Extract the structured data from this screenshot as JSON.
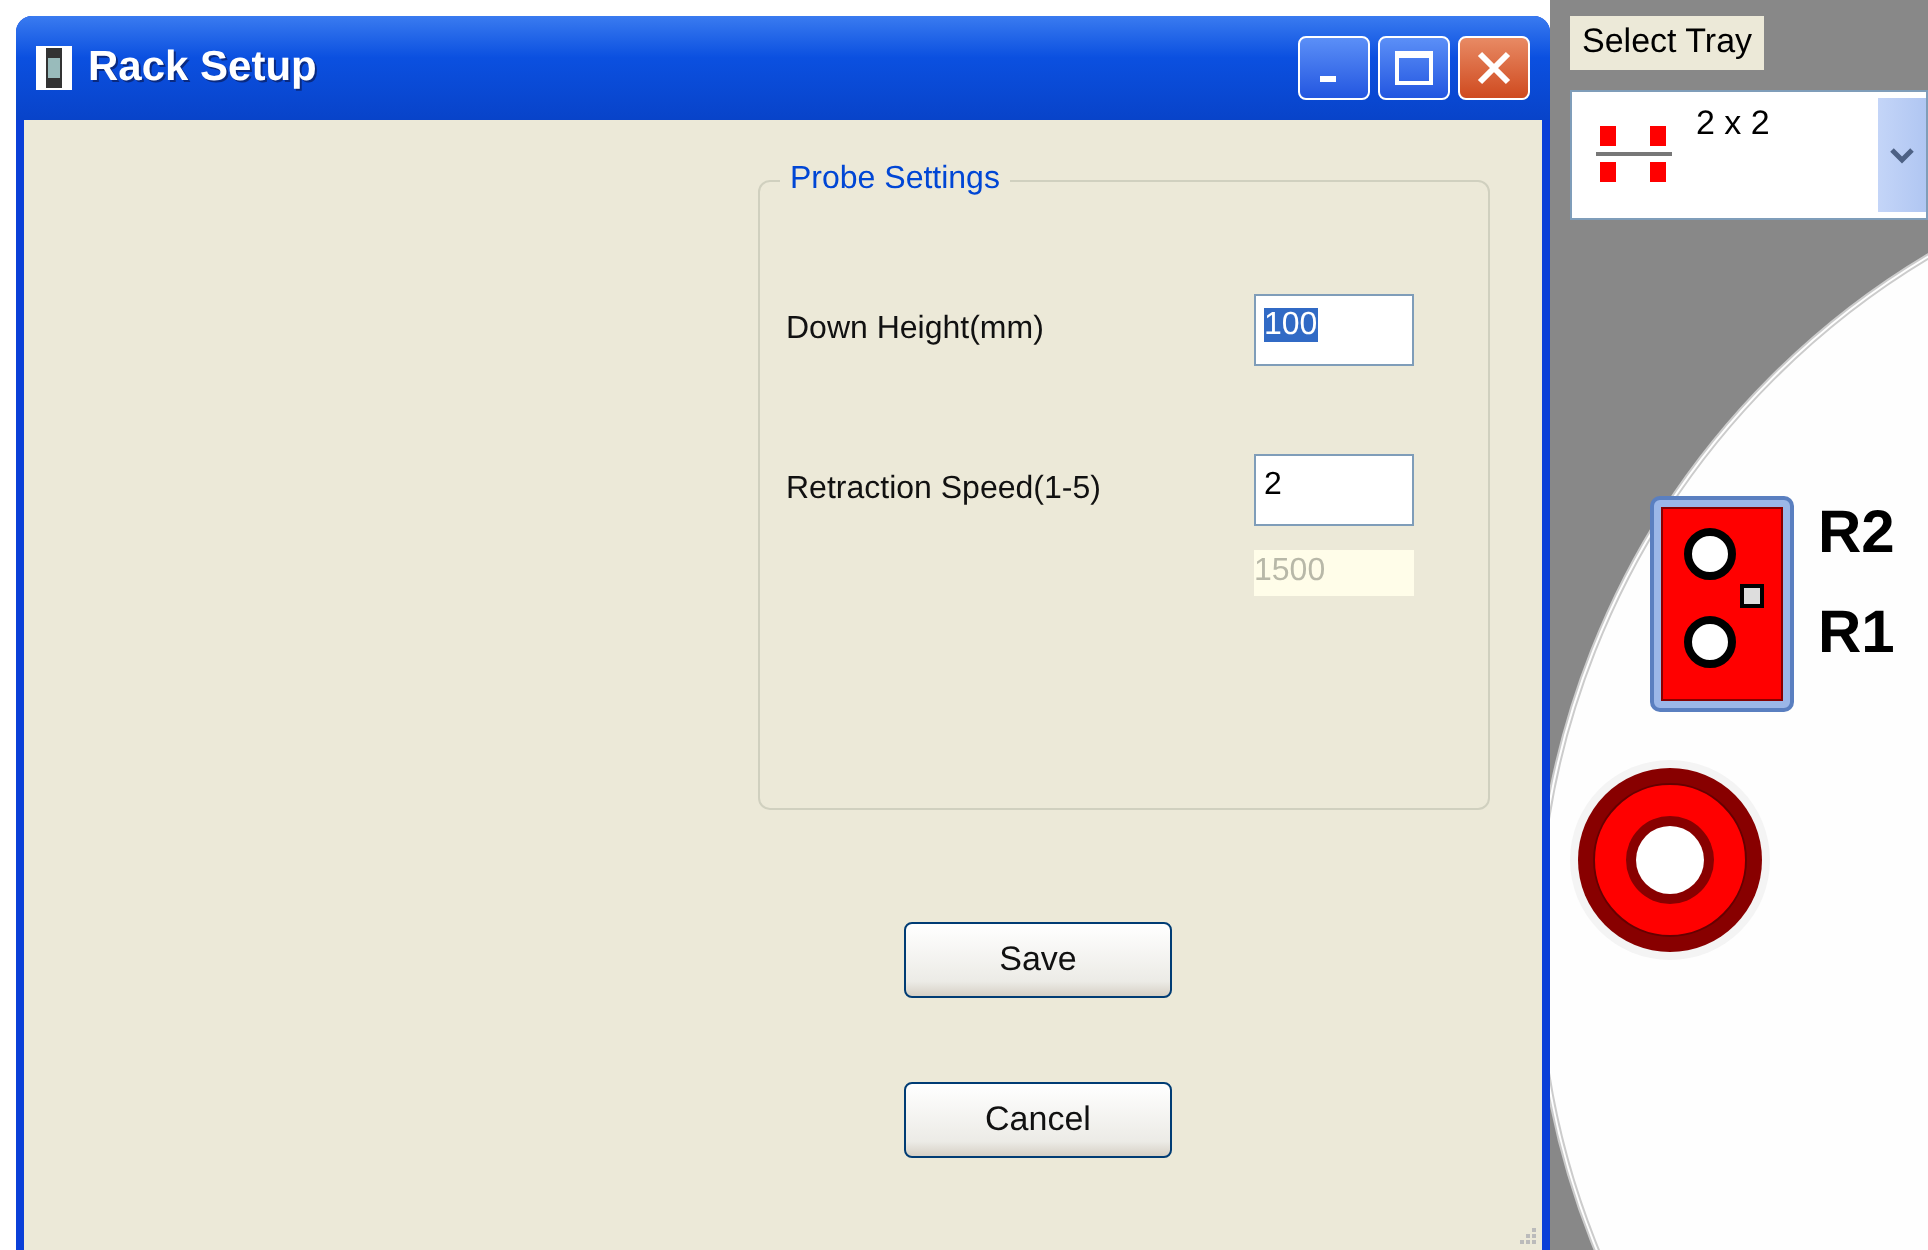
{
  "window": {
    "title": "Rack Setup"
  },
  "probe_settings": {
    "title": "Probe Settings",
    "fields": [
      {
        "label": "Down Height(mm)",
        "value": "100",
        "selected": true
      },
      {
        "label": "Retraction Speed(1-5)",
        "value": "2",
        "selected": false
      }
    ],
    "readout": {
      "value": "1500",
      "disabled": true
    }
  },
  "buttons": [
    "Save",
    "Cancel"
  ],
  "tray": {
    "label": "Select Tray",
    "value": "2 x 2"
  },
  "rack": {
    "labels": [
      "R2",
      "R1"
    ]
  }
}
